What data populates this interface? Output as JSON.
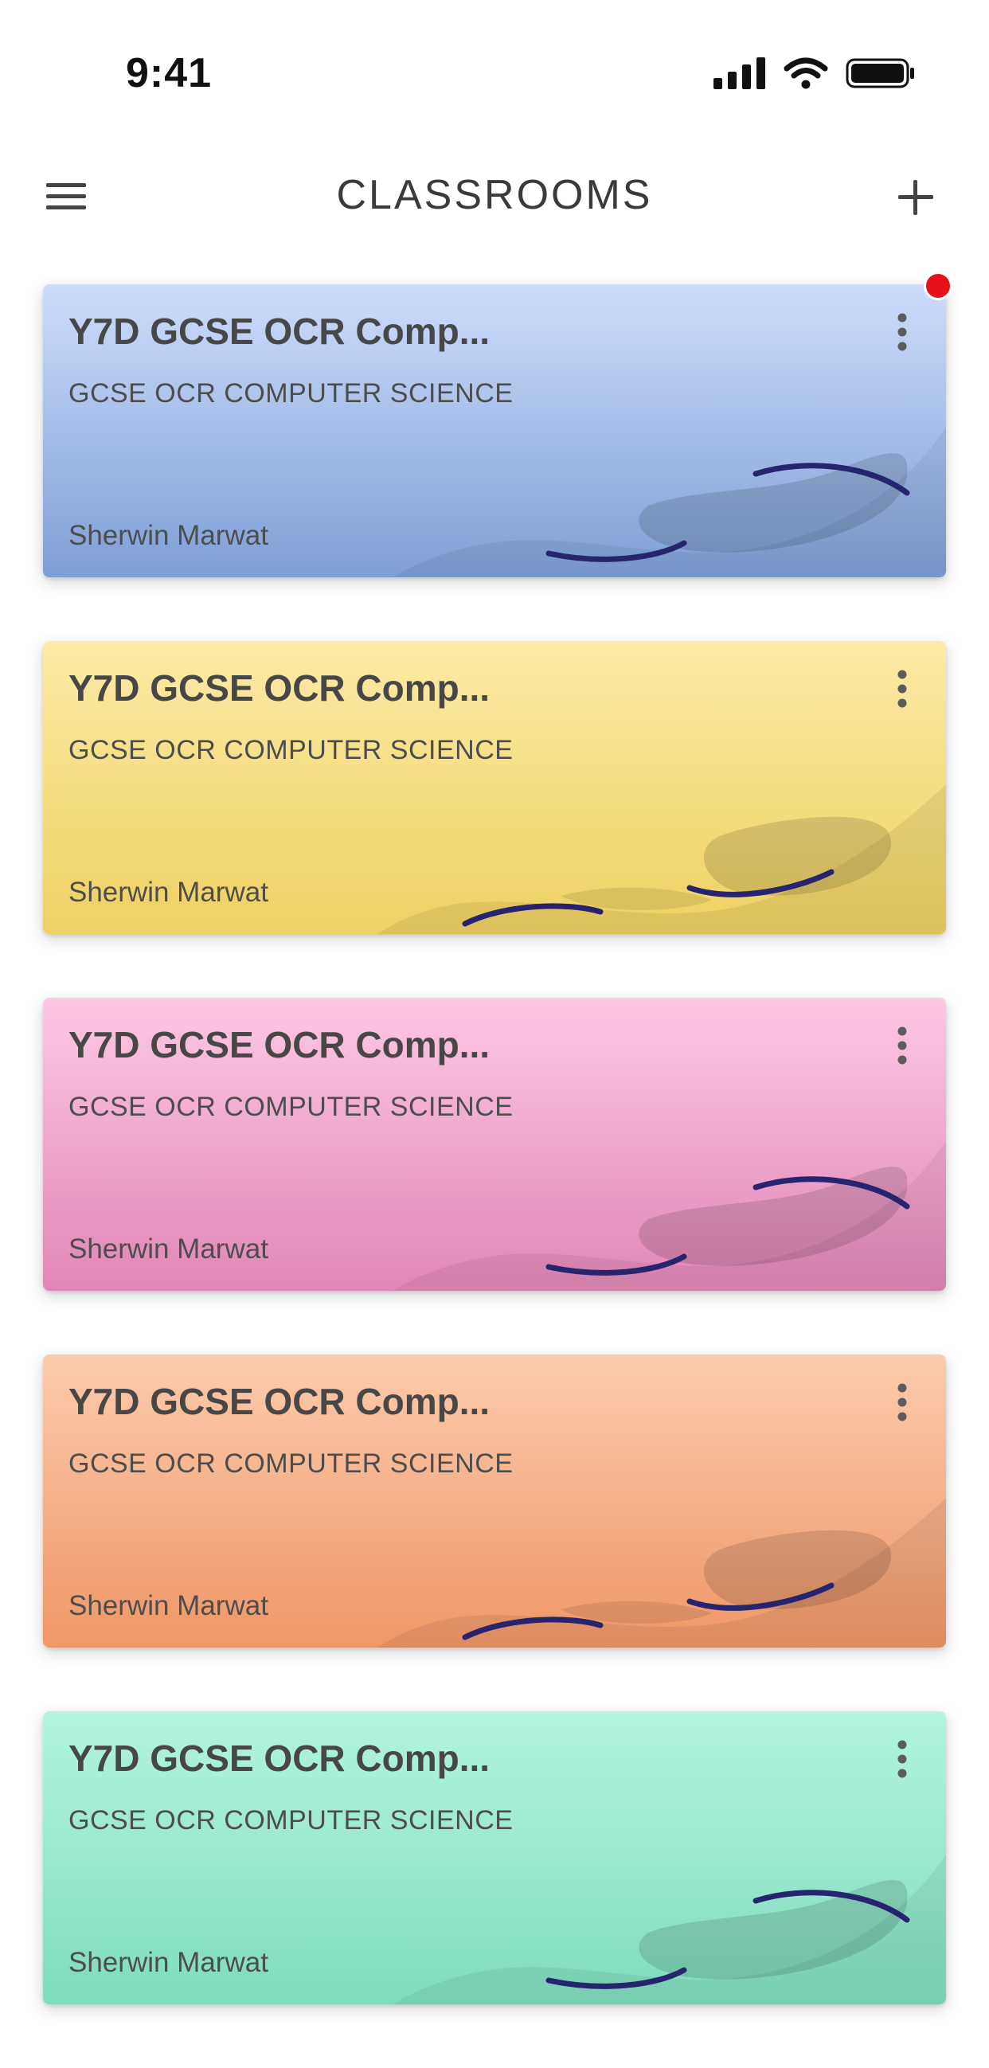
{
  "status": {
    "time": "9:41",
    "icons": [
      "cellular-signal-icon",
      "wifi-icon",
      "battery-icon"
    ]
  },
  "header": {
    "title": "CLASSROOMS",
    "menu_icon": "hamburger-menu-icon",
    "add_icon": "plus-icon"
  },
  "classrooms": [
    {
      "title": "Y7D GCSE OCR Comp...",
      "subtitle": "GCSE OCR COMPUTER SCIENCE",
      "teacher": "Sherwin Marwat",
      "color_top": "#cfdcfb",
      "color_bottom": "#7e9fd6",
      "has_notification": true
    },
    {
      "title": "Y7D GCSE OCR Comp...",
      "subtitle": "GCSE OCR COMPUTER SCIENCE",
      "teacher": "Sherwin Marwat",
      "color_top": "#fbeba6",
      "color_bottom": "#efd062",
      "has_notification": false
    },
    {
      "title": "Y7D GCSE OCR Comp...",
      "subtitle": "GCSE OCR COMPUTER SCIENCE",
      "teacher": "Sherwin Marwat",
      "color_top": "#fdc8e4",
      "color_bottom": "#e186b6",
      "has_notification": false
    },
    {
      "title": "Y7D GCSE OCR Comp...",
      "subtitle": "GCSE OCR COMPUTER SCIENCE",
      "teacher": "Sherwin Marwat",
      "color_top": "#fccbac",
      "color_bottom": "#ef9767",
      "has_notification": false
    },
    {
      "title": "Y7D GCSE OCR Comp...",
      "subtitle": "GCSE OCR COMPUTER SCIENCE",
      "teacher": "Sherwin Marwat",
      "color_top": "#b3f5df",
      "color_bottom": "#7fdcbc",
      "has_notification": false
    }
  ]
}
